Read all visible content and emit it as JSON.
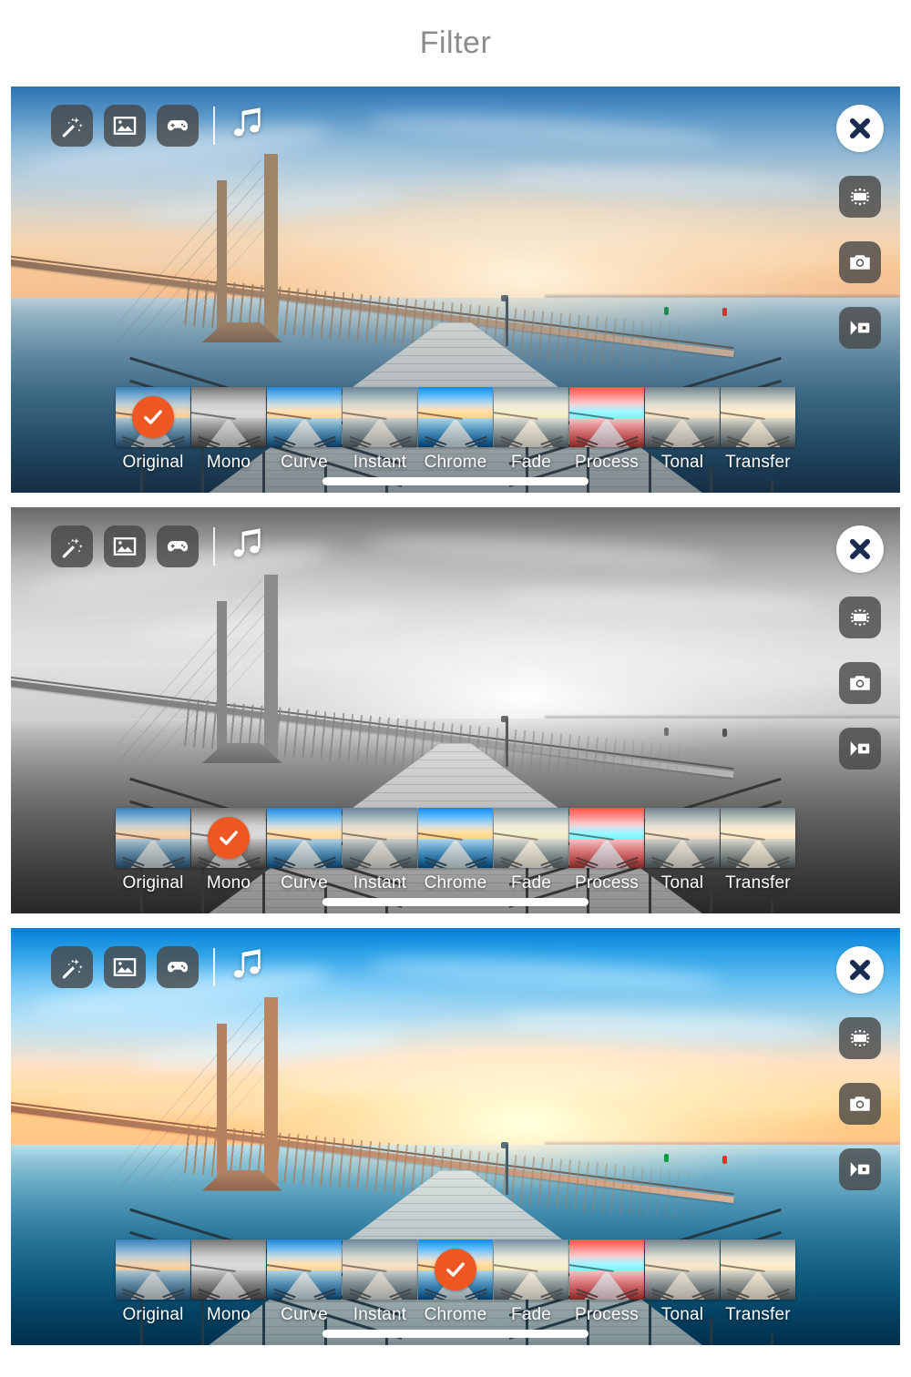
{
  "header": {
    "title": "Filter"
  },
  "colors": {
    "accent_check": "#ee5622",
    "title_text": "#8c8c8c",
    "chip_background": "rgba(70,70,70,0.80)",
    "close_glyph": "#1b2c52",
    "label_text": "#ffffff",
    "page_background": "#ffffff"
  },
  "toolbar_left": {
    "items": [
      {
        "icon": "magic-wand-icon",
        "label": "Effects"
      },
      {
        "icon": "photo-image-icon",
        "label": "Image"
      },
      {
        "icon": "game-controller-icon",
        "label": "Games"
      }
    ],
    "divider": true,
    "music": {
      "icon": "music-note-icon",
      "label": "Music"
    }
  },
  "toolbar_right": {
    "close": {
      "icon": "close-x-icon",
      "label": "Close"
    },
    "items": [
      {
        "icon": "rotate-frame-icon",
        "label": "Frame"
      },
      {
        "icon": "camera-icon",
        "label": "Photo"
      },
      {
        "icon": "video-camera-icon",
        "label": "Video"
      }
    ]
  },
  "filters": [
    {
      "id": "original",
      "label": "Original"
    },
    {
      "id": "mono",
      "label": "Mono"
    },
    {
      "id": "curve",
      "label": "Curve"
    },
    {
      "id": "instant",
      "label": "Instant"
    },
    {
      "id": "chrome",
      "label": "Chrome"
    },
    {
      "id": "fade",
      "label": "Fade"
    },
    {
      "id": "process",
      "label": "Process"
    },
    {
      "id": "tonal",
      "label": "Tonal"
    },
    {
      "id": "transfer",
      "label": "Transfer"
    }
  ],
  "panels": [
    {
      "index": 1,
      "selected_filter": "Original",
      "selected_index": 0,
      "look": "original"
    },
    {
      "index": 2,
      "selected_filter": "Mono",
      "selected_index": 1,
      "look": "mono"
    },
    {
      "index": 3,
      "selected_filter": "Chrome",
      "selected_index": 4,
      "look": "chrome"
    }
  ],
  "scene": {
    "description": "Long bridge over calm water at sunset with a wooden pier leading to the horizon"
  }
}
